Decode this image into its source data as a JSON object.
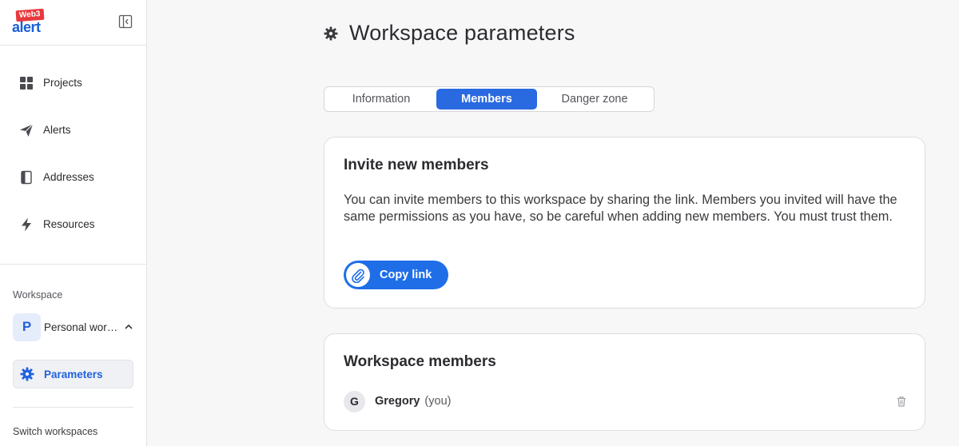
{
  "app": {
    "logo_badge": "Web3",
    "logo_text": "alert"
  },
  "sidebar": {
    "nav": [
      {
        "label": "Projects",
        "icon": "grid-icon"
      },
      {
        "label": "Alerts",
        "icon": "paper-plane-icon"
      },
      {
        "label": "Addresses",
        "icon": "book-icon"
      },
      {
        "label": "Resources",
        "icon": "lightning-icon"
      }
    ],
    "workspace_label": "Workspace",
    "workspace": {
      "avatar_letter": "P",
      "name": "Personal workspace"
    },
    "parameters_label": "Parameters",
    "switch_label": "Switch workspaces"
  },
  "page": {
    "title": "Workspace parameters"
  },
  "tabs": [
    {
      "label": "Information",
      "active": false
    },
    {
      "label": "Members",
      "active": true
    },
    {
      "label": "Danger zone",
      "active": false
    }
  ],
  "invite": {
    "title": "Invite new members",
    "description": "You can invite members to this workspace by sharing the link. Members you invited will have the same permissions as you have, so be careful when adding new members. You must trust them.",
    "copy_label": "Copy link"
  },
  "members": {
    "title": "Workspace members",
    "list": [
      {
        "initial": "G",
        "name": "Gregory",
        "tag": "(you)"
      }
    ]
  },
  "colors": {
    "accent": "#2a6ae0",
    "brand_red": "#e8383d",
    "brand_blue": "#1b5fd6"
  }
}
